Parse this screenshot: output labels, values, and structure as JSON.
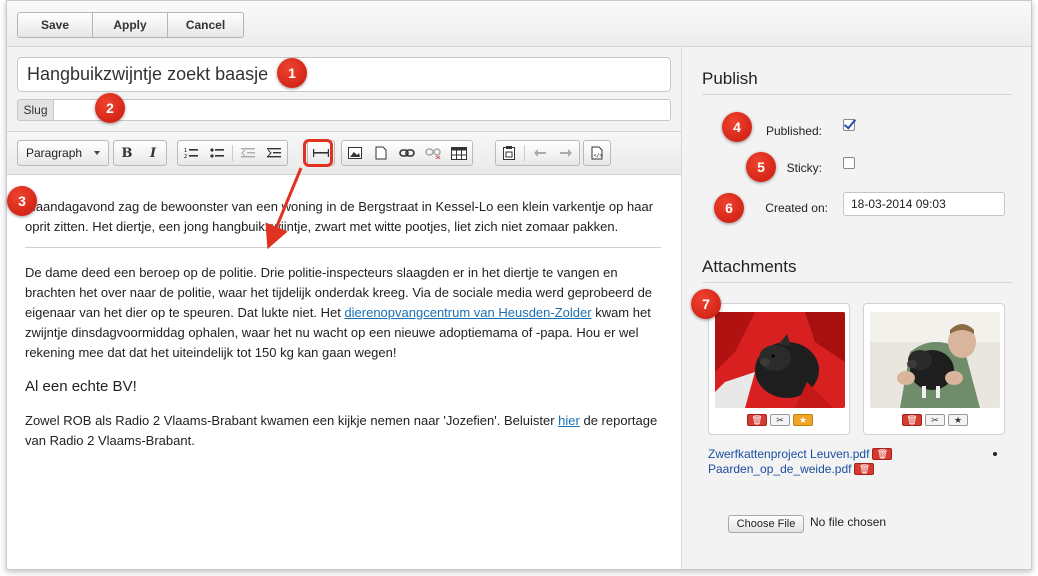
{
  "toolbar": {
    "save": "Save",
    "apply": "Apply",
    "cancel": "Cancel"
  },
  "title_value": "Hangbuikzwijntje zoekt baasje",
  "slug": {
    "label": "Slug",
    "value": ""
  },
  "editor_toolbar": {
    "format_select": "Paragraph",
    "icons": [
      "bold-icon",
      "italic-icon",
      "ordered-list-icon",
      "unordered-list-icon",
      "outdent-icon",
      "indent-icon",
      "horizontal-rule-icon",
      "image-icon",
      "file-icon",
      "link-icon",
      "unlink-icon",
      "table-icon",
      "paste-icon",
      "undo-icon",
      "redo-icon",
      "source-code-icon"
    ]
  },
  "content": {
    "p1": "Maandagavond zag de bewoonster van een woning in de Bergstraat in Kessel-Lo een klein varkentje op haar oprit zitten. Het diertje, een jong hangbuikzwijntje, zwart met witte pootjes, liet zich niet zomaar pakken.",
    "p2_a": "De dame deed een beroep op de politie. Drie politie-inspecteurs slaagden er in het diertje te vangen en brachten het over naar de politie, waar het tijdelijk onderdak kreeg. Via de sociale media werd geprobeerd de eigenaar van het dier op te speuren. Dat lukte niet. Het ",
    "p2_link": "dierenopvangcentrum van Heusden-Zolder",
    "p2_b": " kwam het zwijntje dinsdagvoormiddag ophalen, waar het nu wacht op een nieuwe adoptiemama of -papa. Hou er wel rekening mee dat dat het uiteindelijk tot 150 kg kan gaan wegen!",
    "heading": "Al een echte BV!",
    "p3_a": "Zowel ROB als Radio 2 Vlaams-Brabant kwamen een kijkje nemen naar 'Jozefien'. Beluister ",
    "p3_link": "hier",
    "p3_b": " de reportage van Radio 2 Vlaams-Brabant."
  },
  "publish": {
    "title": "Publish",
    "published_label": "Published:",
    "published": true,
    "sticky_label": "Sticky:",
    "sticky": false,
    "created_label": "Created on:",
    "created_value": "18-03-2014 09:03"
  },
  "attachments": {
    "title": "Attachments",
    "files": [
      "Zwerfkattenproject Leuven.pdf",
      "Paarden_op_de_weide.pdf"
    ],
    "choose_file": "Choose File",
    "no_file": "No file chosen"
  },
  "callouts": [
    "1",
    "2",
    "3",
    "4",
    "5",
    "6",
    "7"
  ],
  "colors": {
    "callout_red": "#d9261a",
    "link": "#1a6fb5",
    "featured_star": "#f0a524"
  }
}
